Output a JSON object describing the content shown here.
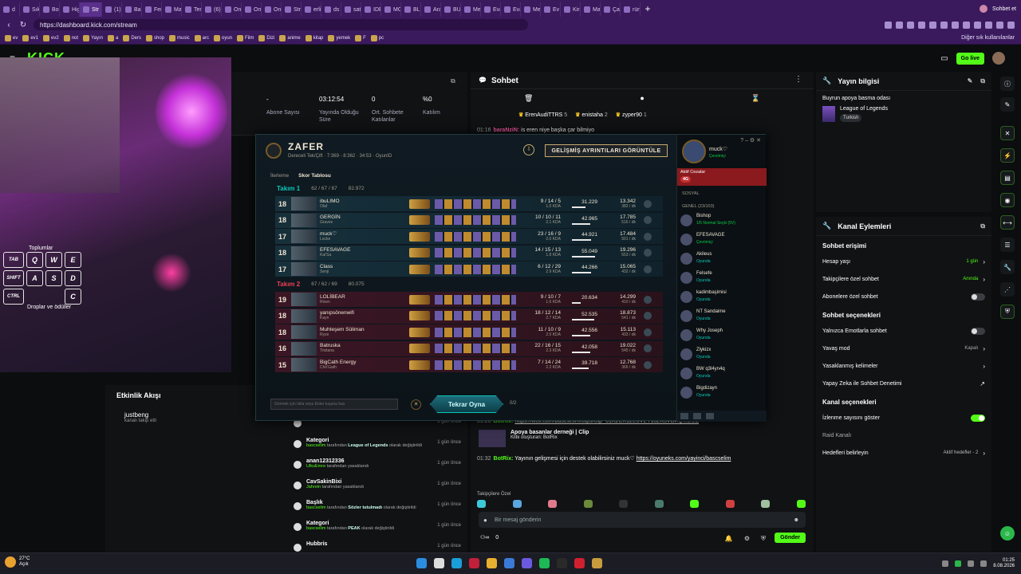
{
  "browser": {
    "tabs": [
      "d",
      "Sık Kul",
      "Bookm",
      "High S",
      "Str",
      "(1) You",
      "Banyo",
      "Femini",
      "Manifi",
      "Tengel",
      "(6) Inst",
      "Online",
      "Online",
      "Online",
      "Stream",
      "erlik im",
      "ds",
      "satabil",
      "IDENC",
      "MOB!",
      "BLUE",
      "Arakat",
      "BURSA",
      "Mesaj",
      "Evarka",
      "Evarka",
      "Mesaj",
      "Ev Ban",
      "Kirala",
      "Makin",
      "Çamaş",
      "rüneş"
    ],
    "active_tab": "Str",
    "profile_label": "Sohbet et",
    "url": "https://dashboard.kick.com/stream",
    "bookmarks": [
      "ev",
      "ev1",
      "ev2",
      "not",
      "Yayın",
      "a",
      "Ders",
      "shop",
      "music",
      "arc",
      "oyun",
      "Film",
      "Dizi",
      "anime",
      "kitap",
      "yemek",
      "F",
      "pc"
    ],
    "other_bookmarks": "Diğer sık kullanılanlar"
  },
  "appbar": {
    "logo": "KICK",
    "beta": "BETA",
    "golive": "Go live"
  },
  "overlay": {
    "label_top": "Toplumlar",
    "label_bottom": "Droplar ve ödüller",
    "keys_row1": [
      "TAB",
      "Q",
      "W",
      "E"
    ],
    "keys_row2": [
      "SHIFT",
      "A",
      "S",
      "D"
    ],
    "keys_row3": [
      "CTRL",
      "C"
    ]
  },
  "stats": [
    {
      "value": "-",
      "label": "Abone Sayısı"
    },
    {
      "value": "03:12:54",
      "label": "Yayında Olduğu Süre"
    },
    {
      "value": "0",
      "label": "Ort. Sohbete Katılanlar"
    },
    {
      "value": "%0",
      "label": "Katılım"
    }
  ],
  "activity": {
    "title": "Etkinlik Akışı",
    "follow_name": "justbeng",
    "follow_desc": "kanalı takip etti",
    "items": [
      {
        "title": "",
        "who": "bascselim",
        "middle": "tarafından",
        "bold": "Apoya basanlar derneği",
        "end": "olarak değiştirildi",
        "time": "1 gün önce"
      },
      {
        "title": "Kategori",
        "who": "bascselim",
        "middle": "tarafından",
        "bold": "League of Legends",
        "end": "olarak değiştirildi",
        "time": "1 gün önce"
      },
      {
        "title": "anan12312336",
        "who": "UlkuEmre",
        "middle": "tarafından yasaklandı",
        "bold": "",
        "end": "",
        "time": "1 gün önce"
      },
      {
        "title": "CavSakinBixi",
        "who": "Jahrein",
        "middle": "tarafından yasaklandı",
        "bold": "",
        "end": "",
        "time": "1 gün önce"
      },
      {
        "title": "Başlık",
        "who": "bascselim",
        "middle": "tarafından",
        "bold": "Sözler tutulmadı",
        "end": "olarak değiştirildi",
        "time": "1 gün önce"
      },
      {
        "title": "Kategori",
        "who": "bascselim",
        "middle": "tarafından",
        "bold": "PEAK",
        "end": "olarak değiştirildi",
        "time": "1 gün önce"
      },
      {
        "title": "Hubbris",
        "who": "",
        "middle": "",
        "bold": "",
        "end": "",
        "time": "1 gün önce"
      }
    ]
  },
  "chat": {
    "title": "Sohbet",
    "pinned": [
      {
        "name": "ErenAudiTTRS",
        "count": "5"
      },
      {
        "name": "enistaha",
        "count": "2"
      },
      {
        "name": "zyper90",
        "count": "1"
      }
    ],
    "msg1": {
      "time": "01:16",
      "user": "baraNziN:",
      "text": "is eren niye başka çar bilmiyo"
    },
    "msg2": {
      "time": "01:28",
      "user": "BotRix:",
      "link": "https://kick.com/bascselim/clips/clip_01K2CK1ZE6VET18ZK3VDAQMBUB"
    },
    "clip": {
      "title": "Apoya basanlar derneği | Clip",
      "sub": "Klibi oluşturan: BotRix"
    },
    "msg3": {
      "time": "01:32",
      "user": "BotRix:",
      "text": "Yayının gelişmesi için destek olabilirsiniz muck♡",
      "link": "https://oyuneks.com/yayinci/bascselim"
    },
    "emote_header": "Takipçilere Özel",
    "input_placeholder": "Bir mesaj gönderin",
    "viewers": "0",
    "send": "Gönder"
  },
  "stream_info": {
    "title": "Yayın bilgisi",
    "stream_title": "Buyrun apoya basma odası",
    "game": "League of Legends",
    "tag": "Turkish"
  },
  "channel_actions": {
    "title": "Kanal Eylemleri",
    "sec1": "Sohbet erişimi",
    "account_age": {
      "label": "Hesap yaşı",
      "value": "1 gün"
    },
    "followers_only": {
      "label": "Takipçilere özel sohbet",
      "value": "Anında"
    },
    "subs_only": {
      "label": "Abonelere özel sohbet"
    },
    "sec2": "Sohbet seçenekleri",
    "emote_only": {
      "label": "Yalnızca Emotlarla sohbet"
    },
    "slow_mode": {
      "label": "Yavaş mod",
      "value": "Kapalı"
    },
    "banned_words": {
      "label": "Yasaklanmış kelimeler"
    },
    "ai_moderation": {
      "label": "Yapay Zeka ile Sohbet Denetimi"
    },
    "sec3": "Kanal seçenekleri",
    "show_viewers": {
      "label": "İzlenme sayısını göster"
    },
    "raid": {
      "label": "Raid Kanalı"
    },
    "goals": {
      "label": "Hedefleri belirleyin",
      "value": "Aktif hedefler - 2"
    }
  },
  "game": {
    "result": "ZAFER",
    "subtitle": "Dereceli Tek/Çift  ·  7:369 - 8:362  ·  34:53  ·  OyunID",
    "detail_button": "GELİŞMİŞ AYRINTILARI GÖRÜNTÜLE",
    "tabs": [
      "İlerleme",
      "Skor Tablosu"
    ],
    "team1": {
      "name": "Takım 1",
      "kda": "62 / 67 / 67",
      "gold": "82.972"
    },
    "team2": {
      "name": "Takım 2",
      "kda": "67 / 62 / 69",
      "gold": "80.075"
    },
    "players": [
      {
        "lv": "18",
        "name": "ibuLIMO",
        "champ": "Olaf",
        "kda": "9 / 14 / 5",
        "kda_sub": "1.0 KDA",
        "dmg": "31.229",
        "gold": "13.342",
        "cs": "382 / dk"
      },
      {
        "lv": "18",
        "name": "GERGİN",
        "champ": "Graves",
        "kda": "10 / 10 / 11",
        "kda_sub": "2.1 KDA",
        "dmg": "42.965",
        "gold": "17.785",
        "cs": "516 / dk"
      },
      {
        "lv": "17",
        "name": "muck♡",
        "champ": "Locke",
        "kda": "23 / 16 / 9",
        "kda_sub": "2.0 KDA",
        "dmg": "44.921",
        "gold": "17.484",
        "cs": "501 / dk"
      },
      {
        "lv": "18",
        "name": "EFESAVAGE",
        "champ": "Kai'Sa",
        "kda": "14 / 15 / 13",
        "kda_sub": "1.8 KDA",
        "dmg": "55.049",
        "gold": "19.296",
        "cs": "553 / dk"
      },
      {
        "lv": "17",
        "name": "Class",
        "champ": "Senji",
        "kda": "6 / 12 / 29",
        "kda_sub": "2.9 KDA",
        "dmg": "44.266",
        "gold": "15.065",
        "cs": "432 / dk"
      },
      {
        "lv": "19",
        "name": "LOLİBEAR",
        "champ": "Riven",
        "kda": "9 / 10 / 7",
        "kda_sub": "1.6 KDA",
        "dmg": "20.634",
        "gold": "14.299",
        "cs": "410 / dk"
      },
      {
        "lv": "18",
        "name": "yanıpsönenwifi",
        "champ": "Kayn",
        "kda": "18 / 12 / 14",
        "kda_sub": "2.7 KDA",
        "dmg": "52.535",
        "gold": "18.873",
        "cs": "541 / dk"
      },
      {
        "lv": "18",
        "name": "Muhteşem Süliman",
        "champ": "Ryze",
        "kda": "11 / 10 / 9",
        "kda_sub": "2.0 KDA",
        "dmg": "42.556",
        "gold": "15.113",
        "cs": "433 / dk"
      },
      {
        "lv": "16",
        "name": "Batruska",
        "champ": "Tristana",
        "kda": "22 / 16 / 15",
        "kda_sub": "2.3 KDA",
        "dmg": "42.058",
        "gold": "19.022",
        "cs": "545 / dk"
      },
      {
        "lv": "15",
        "name": "BigCath Energy",
        "champ": "Cho'Gath",
        "kda": "7 / 14 / 24",
        "kda_sub": "2.2 KDA",
        "dmg": "39.718",
        "gold": "12.768",
        "cs": "366 / dk"
      }
    ],
    "chat_placeholder": "Görmek için tıkla veya Enter tuşuna bas",
    "play_again": "Tekrar Oyna",
    "party_count": "0/2",
    "side": {
      "me": "muck♡",
      "status": "Çevrimiçi",
      "penalty": "Aktif Cezalar",
      "penalty_badge": "4G",
      "social": "SOSYAL",
      "group": "GENEL (23/103)",
      "friends": [
        {
          "name": "Bishop",
          "status": "1/5 Normal Seçki (5V)"
        },
        {
          "name": "EFESAVAGE",
          "status": "Çevrimiçi"
        },
        {
          "name": "Akileus",
          "status": "Oyunda"
        },
        {
          "name": "Felsefe",
          "status": "Oyunda"
        },
        {
          "name": "kadimbaşimisi",
          "status": "Oyunda"
        },
        {
          "name": "NT Sandaime",
          "status": "Oyunda"
        },
        {
          "name": "Why Joseph",
          "status": "Oyunda"
        },
        {
          "name": "Zlykizx",
          "status": "Oyunda"
        },
        {
          "name": "BW q3l4yn4q",
          "status": "Oyunda"
        },
        {
          "name": "Bigdizayn",
          "status": "Oyunda"
        }
      ]
    }
  },
  "taskbar": {
    "temp": "27°C",
    "weather": "Açık",
    "time": "01:25",
    "date": "8.08.2026"
  }
}
